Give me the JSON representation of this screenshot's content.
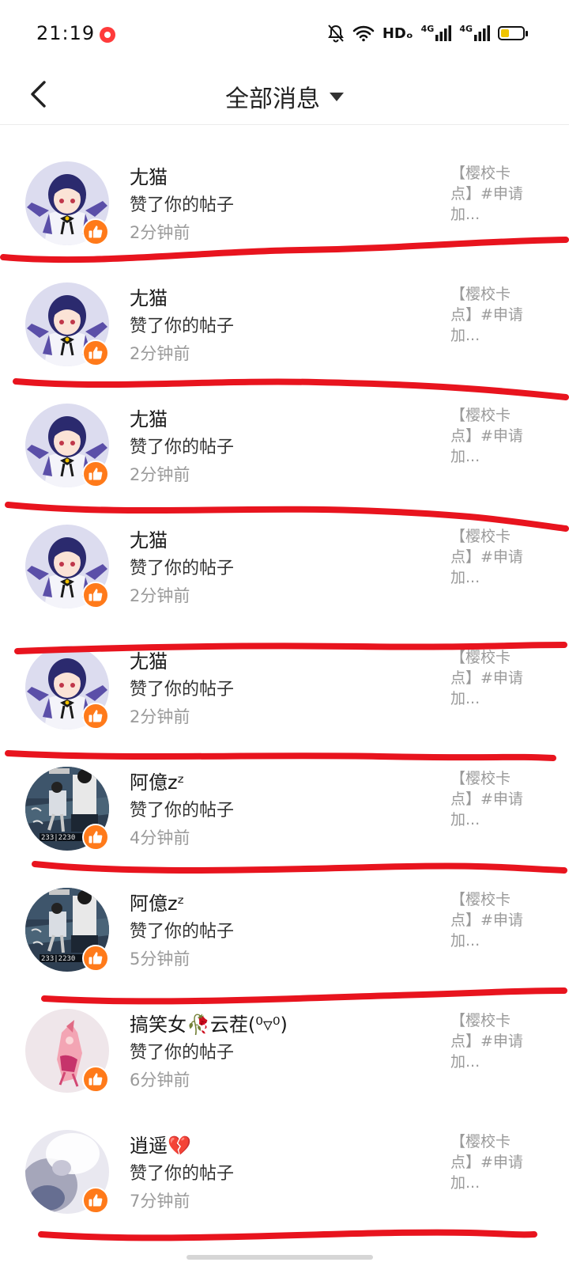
{
  "status_bar": {
    "time": "21:19",
    "network_label": "HDₒ",
    "net_type_1": "4G",
    "net_type_2": "4G",
    "icons": [
      "record-icon",
      "mute-bell-icon",
      "wifi-icon",
      "hd-icon",
      "signal-icon",
      "signal-icon",
      "battery-icon"
    ],
    "battery_level": 0.35,
    "colors": {
      "record": "#ff3b3b",
      "battery": "#f0c400"
    }
  },
  "header": {
    "back_icon": "back-arrow-icon",
    "title": "全部消息",
    "dropdown_icon": "caret-down-icon"
  },
  "notifications": [
    {
      "name": "尢猫",
      "action": "赞了你的帖子",
      "time": "2分钟前",
      "post_line1": "【樱校卡",
      "post_line2": "点】#申请",
      "post_line3": "加...",
      "avatar_style": "anime"
    },
    {
      "name": "尢猫",
      "action": "赞了你的帖子",
      "time": "2分钟前",
      "post_line1": "【樱校卡",
      "post_line2": "点】#申请",
      "post_line3": "加...",
      "avatar_style": "anime"
    },
    {
      "name": "尢猫",
      "action": "赞了你的帖子",
      "time": "2分钟前",
      "post_line1": "【樱校卡",
      "post_line2": "点】#申请",
      "post_line3": "加...",
      "avatar_style": "anime"
    },
    {
      "name": "尢猫",
      "action": "赞了你的帖子",
      "time": "2分钟前",
      "post_line1": "【樱校卡",
      "post_line2": "点】#申请",
      "post_line3": "加...",
      "avatar_style": "anime"
    },
    {
      "name": "尢猫",
      "action": "赞了你的帖子",
      "time": "2分钟前",
      "post_line1": "【樱校卡",
      "post_line2": "点】#申请",
      "post_line3": "加...",
      "avatar_style": "anime"
    },
    {
      "name": "阿億zᶻ",
      "action": "赞了你的帖子",
      "time": "4分钟前",
      "post_line1": "【樱校卡",
      "post_line2": "点】#申请",
      "post_line3": "加...",
      "avatar_style": "photo"
    },
    {
      "name": "阿億zᶻ",
      "action": "赞了你的帖子",
      "time": "5分钟前",
      "post_line1": "【樱校卡",
      "post_line2": "点】#申请",
      "post_line3": "加...",
      "avatar_style": "photo"
    },
    {
      "name": "搞笑女🥀云茬(⁰▿⁰)",
      "action": "赞了你的帖子",
      "time": "6分钟前",
      "post_line1": "【樱校卡",
      "post_line2": "点】#申请",
      "post_line3": "加...",
      "avatar_style": "pink"
    },
    {
      "name": "逍遥💔",
      "action": "赞了你的帖子",
      "time": "7分钟前",
      "post_line1": "【樱校卡",
      "post_line2": "点】#申请",
      "post_line3": "加...",
      "avatar_style": "blur"
    }
  ],
  "badge_icon": "thumbs-up-icon",
  "colors": {
    "like_badge": "#ff7a1a",
    "red_mark": "#e8141e"
  }
}
